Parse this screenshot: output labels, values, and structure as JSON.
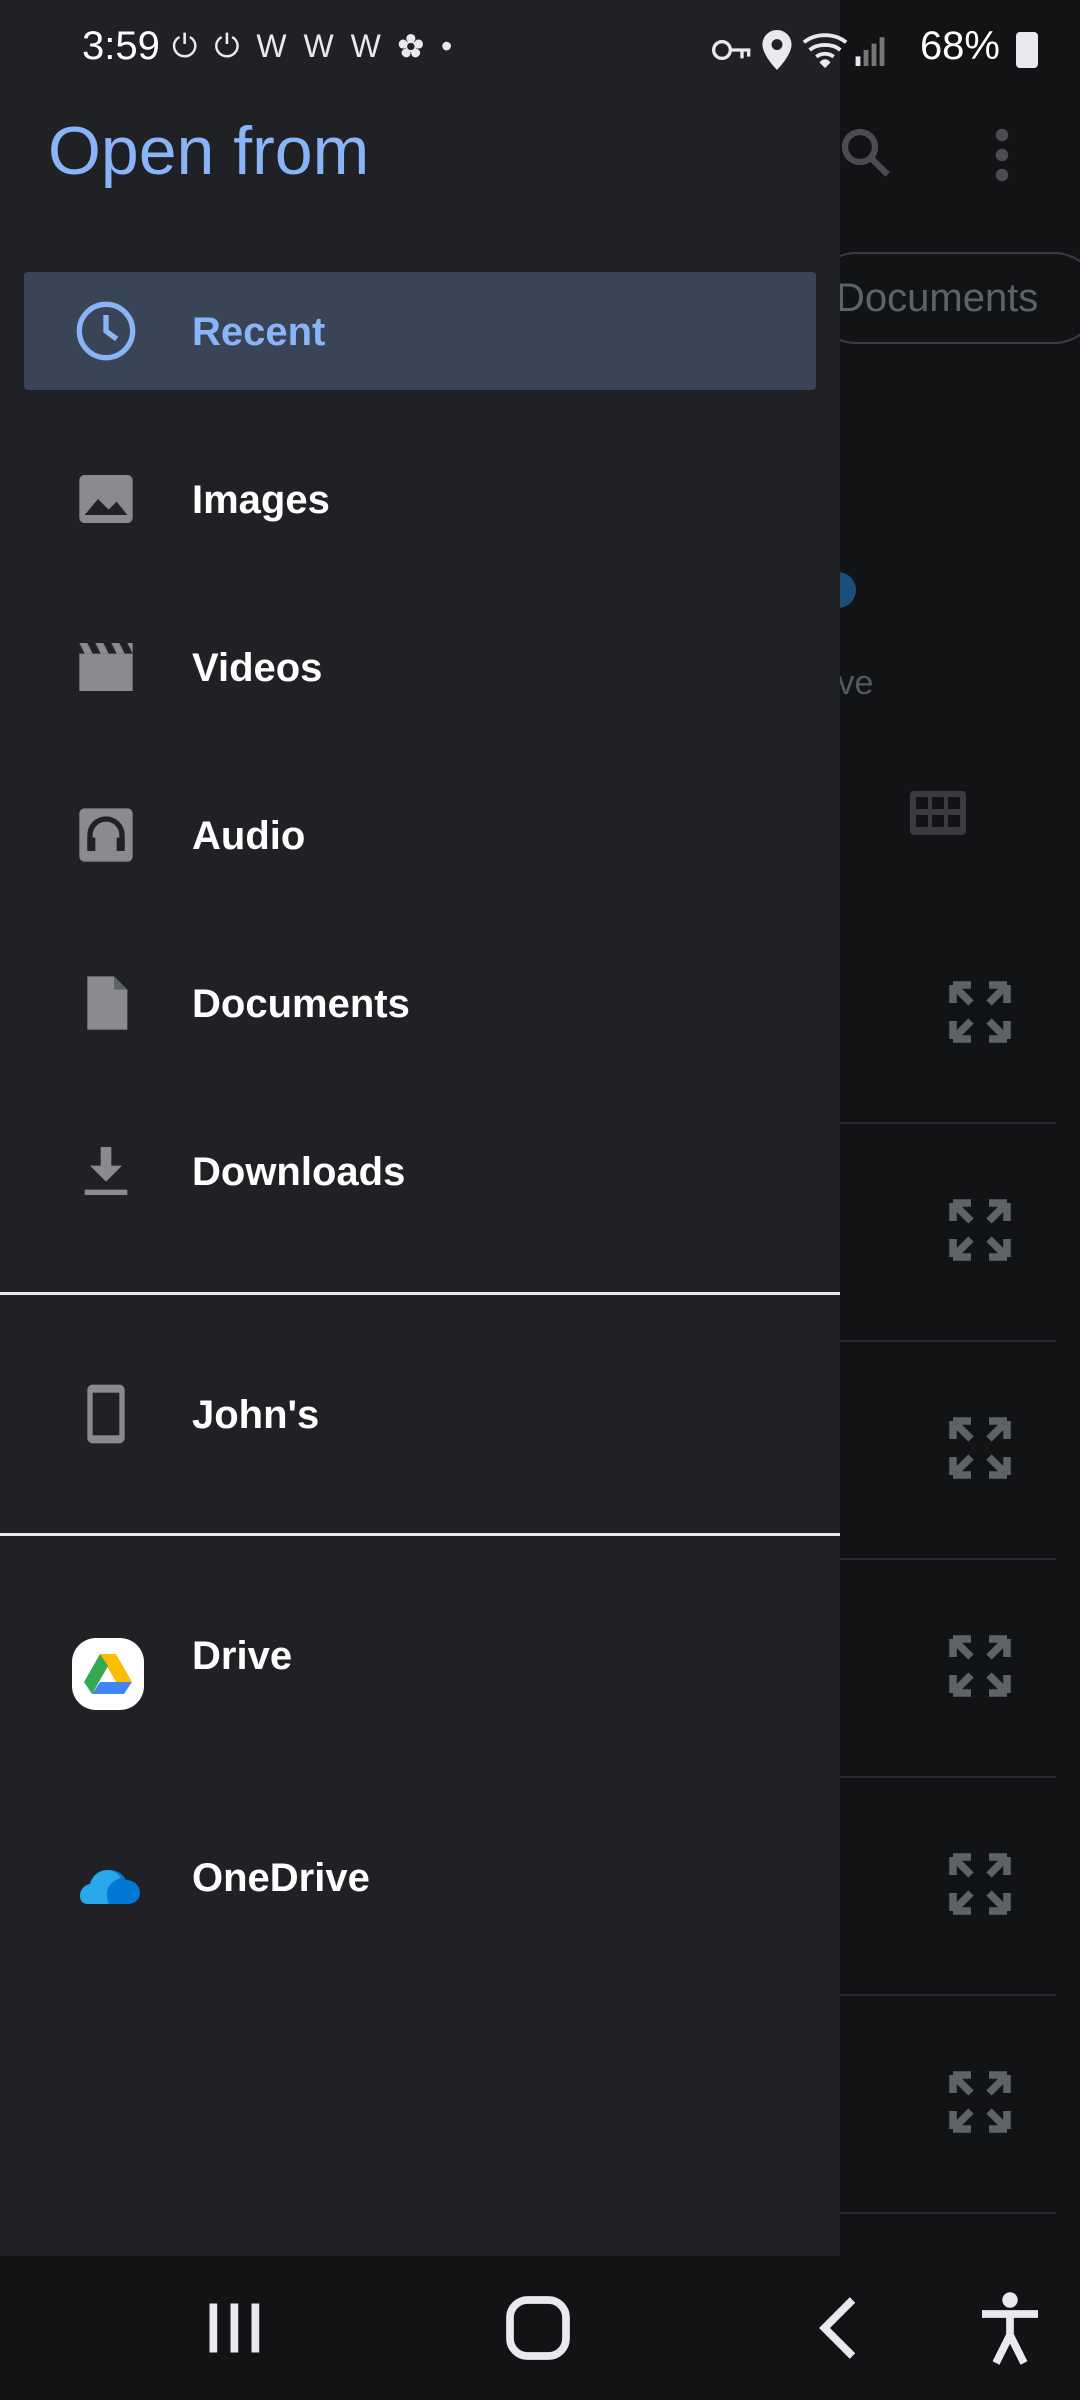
{
  "status_bar": {
    "time": "3:59",
    "left_icons": "⏻ ⏻ W W W ✿ •",
    "battery": "68%"
  },
  "background": {
    "chip_label": "Documents",
    "drive_text": "ive"
  },
  "drawer": {
    "title": "Open from",
    "items": [
      {
        "label": "Recent",
        "icon": "clock-icon",
        "active": true
      },
      {
        "label": "Images",
        "icon": "image-icon"
      },
      {
        "label": "Videos",
        "icon": "video-icon"
      },
      {
        "label": "Audio",
        "icon": "audio-icon"
      },
      {
        "label": "Documents",
        "icon": "document-icon"
      },
      {
        "label": "Downloads",
        "icon": "download-icon"
      }
    ],
    "device": {
      "label": "John's",
      "icon": "phone-icon"
    },
    "cloud": [
      {
        "label": "Drive",
        "icon": "google-drive-icon"
      },
      {
        "label": "OneDrive",
        "icon": "onedrive-icon"
      }
    ]
  },
  "colors": {
    "accent": "#8ab4f8",
    "active_bg": "#394457",
    "drawer_bg": "#202124"
  }
}
